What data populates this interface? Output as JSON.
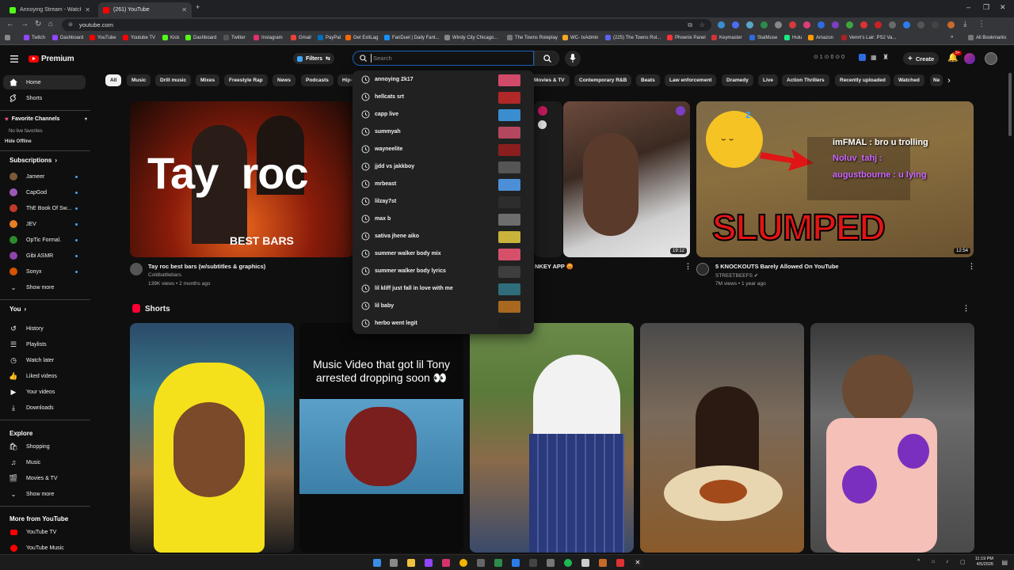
{
  "browser": {
    "tabs": [
      {
        "title": "Annoying Stream - Watch Live",
        "favicon_color": "#53fc18"
      },
      {
        "title": "(261) YouTube",
        "favicon_color": "#ff0000"
      }
    ],
    "url": "youtube.com",
    "bookmarks": [
      {
        "label": "Twitch",
        "color": "#9146ff"
      },
      {
        "label": "Dashboard",
        "color": "#9146ff"
      },
      {
        "label": "YouTube",
        "color": "#ff0000"
      },
      {
        "label": "Youtube TV",
        "color": "#ff0000"
      },
      {
        "label": "Kick",
        "color": "#53fc18"
      },
      {
        "label": "Dashboard",
        "color": "#53fc18"
      },
      {
        "label": "Twitter",
        "color": "#555555"
      },
      {
        "label": "Instagram",
        "color": "#e1306c"
      },
      {
        "label": "Gmail",
        "color": "#ea4335"
      },
      {
        "label": "PayPal",
        "color": "#0070ba"
      },
      {
        "label": "Get ExitLag",
        "color": "#ff6600"
      },
      {
        "label": "FanDuel | Daily Fant...",
        "color": "#1493ff"
      },
      {
        "label": "Windy City Chicago...",
        "color": "#888888"
      },
      {
        "label": "The Towns Roleplay",
        "color": "#777777"
      },
      {
        "label": "WC- txAdmin",
        "color": "#f5a623"
      },
      {
        "label": "(225) The Towns Rol...",
        "color": "#5865f2"
      },
      {
        "label": "Phoenix Panel",
        "color": "#ff3333"
      },
      {
        "label": "Keymaster",
        "color": "#d13438"
      },
      {
        "label": "StatMuse",
        "color": "#2d6cdf"
      },
      {
        "label": "Hulu",
        "color": "#1ce783"
      },
      {
        "label": "Amazon",
        "color": "#ff9900"
      },
      {
        "label": "Venm's Lair: PS2 Va...",
        "color": "#aa2222"
      }
    ],
    "all_bookmarks": "All Bookmarks"
  },
  "youtube": {
    "logo_text": "Premium",
    "filters_label": "Filters",
    "search_placeholder": "Search",
    "create_label": "Create",
    "notifications_badge": "9+",
    "chips": [
      "All",
      "Music",
      "Drill music",
      "Mixes",
      "Freestyle Rap",
      "News",
      "Podcasts",
      "Hip-",
      "Movies & TV",
      "Contemporary R&B",
      "Beats",
      "Law enforcement",
      "Dramedy",
      "Live",
      "Action Thrillers",
      "Recently uploaded",
      "Watched",
      "Ne"
    ]
  },
  "sidebar": {
    "main": [
      {
        "label": "Home",
        "icon": "home-icon"
      },
      {
        "label": "Shorts",
        "icon": "shorts-icon"
      }
    ],
    "favorite_channels_title": "Favorite Channels",
    "no_favorites": "No live favorites",
    "hide_offline": "Hide Offline",
    "subscriptions_title": "Subscriptions",
    "subscriptions": [
      {
        "name": "Jameer",
        "color": "#7a5a3a"
      },
      {
        "name": "CapGod",
        "color": "#9b59b6"
      },
      {
        "name": "ThE Book Of Sw...",
        "color": "#c0392b"
      },
      {
        "name": "JEV",
        "color": "#e67e22"
      },
      {
        "name": "OpTic Formal.",
        "color": "#2c8c2c"
      },
      {
        "name": "Gibi ASMR",
        "color": "#8e44ad"
      },
      {
        "name": "Sonyx",
        "color": "#d35400"
      }
    ],
    "show_more": "Show more",
    "you_title": "You",
    "you_items": [
      {
        "label": "History",
        "icon": "history-icon"
      },
      {
        "label": "Playlists",
        "icon": "playlists-icon"
      },
      {
        "label": "Watch later",
        "icon": "watch-later-icon"
      },
      {
        "label": "Liked videos",
        "icon": "like-icon"
      },
      {
        "label": "Your videos",
        "icon": "your-videos-icon"
      },
      {
        "label": "Downloads",
        "icon": "download-icon"
      }
    ],
    "explore_title": "Explore",
    "explore_items": [
      {
        "label": "Shopping",
        "icon": "shopping-icon"
      },
      {
        "label": "Music",
        "icon": "music-icon"
      },
      {
        "label": "Movies & TV",
        "icon": "movies-icon"
      }
    ],
    "explore_show_more": "Show more",
    "more_title": "More from YouTube",
    "more_items": [
      {
        "label": "YouTube TV",
        "icon": "youtube-tv-icon"
      },
      {
        "label": "YouTube Music",
        "icon": "youtube-music-icon"
      }
    ]
  },
  "videos": [
    {
      "title": "Tay roc best bars (w/subtitles & graphics)",
      "channel": "Coldbattlebars",
      "meta": "139K views • 2 months ago",
      "thumb_text": "Tay  roc",
      "thumb_caption": "BEST BARS"
    },
    {
      "title": "NKEY APP",
      "duration": "19:12"
    },
    {
      "title": "5 KNOCKOUTS Barely Allowed On YouTube",
      "channel": "STREETBEEFS",
      "meta": "7M views • 1 year ago",
      "duration": "12:54",
      "thumb_text": "SLUMPED",
      "overlay_lines": [
        "imFMAL : bro u trolling",
        "Noluv_tahj :",
        "augustbourne : u lying"
      ]
    }
  ],
  "shorts": {
    "title": "Shorts",
    "second_caption": "Music Video that got lil Tony arrested dropping soon 👀"
  },
  "search_suggestions": [
    {
      "text": "annoying 2k17",
      "color": "#d24a6a"
    },
    {
      "text": "hellcats srt",
      "color": "#b02828"
    },
    {
      "text": "capp live",
      "color": "#3a8ed0"
    },
    {
      "text": "summyah",
      "color": "#b3475e"
    },
    {
      "text": "wayneelite",
      "color": "#8a1e1e"
    },
    {
      "text": "jjdd vs jakkboy",
      "color": "#555555"
    },
    {
      "text": "mrbeast",
      "color": "#4c8fd6"
    },
    {
      "text": "lilzay7st",
      "color": "#2d2d2d"
    },
    {
      "text": "max b",
      "color": "#6d6d6d"
    },
    {
      "text": "sativa jhene aiko",
      "color": "#c9b33a"
    },
    {
      "text": "summer walker body mix",
      "color": "#d6506a"
    },
    {
      "text": "summer walker body lyrics",
      "color": "#3e3e3e"
    },
    {
      "text": "lil kliff just fall in love with me",
      "color": "#2f6d7a"
    },
    {
      "text": "lil baby",
      "color": "#a86820"
    },
    {
      "text": "herbo went legit",
      "color": "#1e1e1e"
    }
  ],
  "taskbar": {
    "time": "11:19 PM",
    "date": "4/5/2026"
  }
}
